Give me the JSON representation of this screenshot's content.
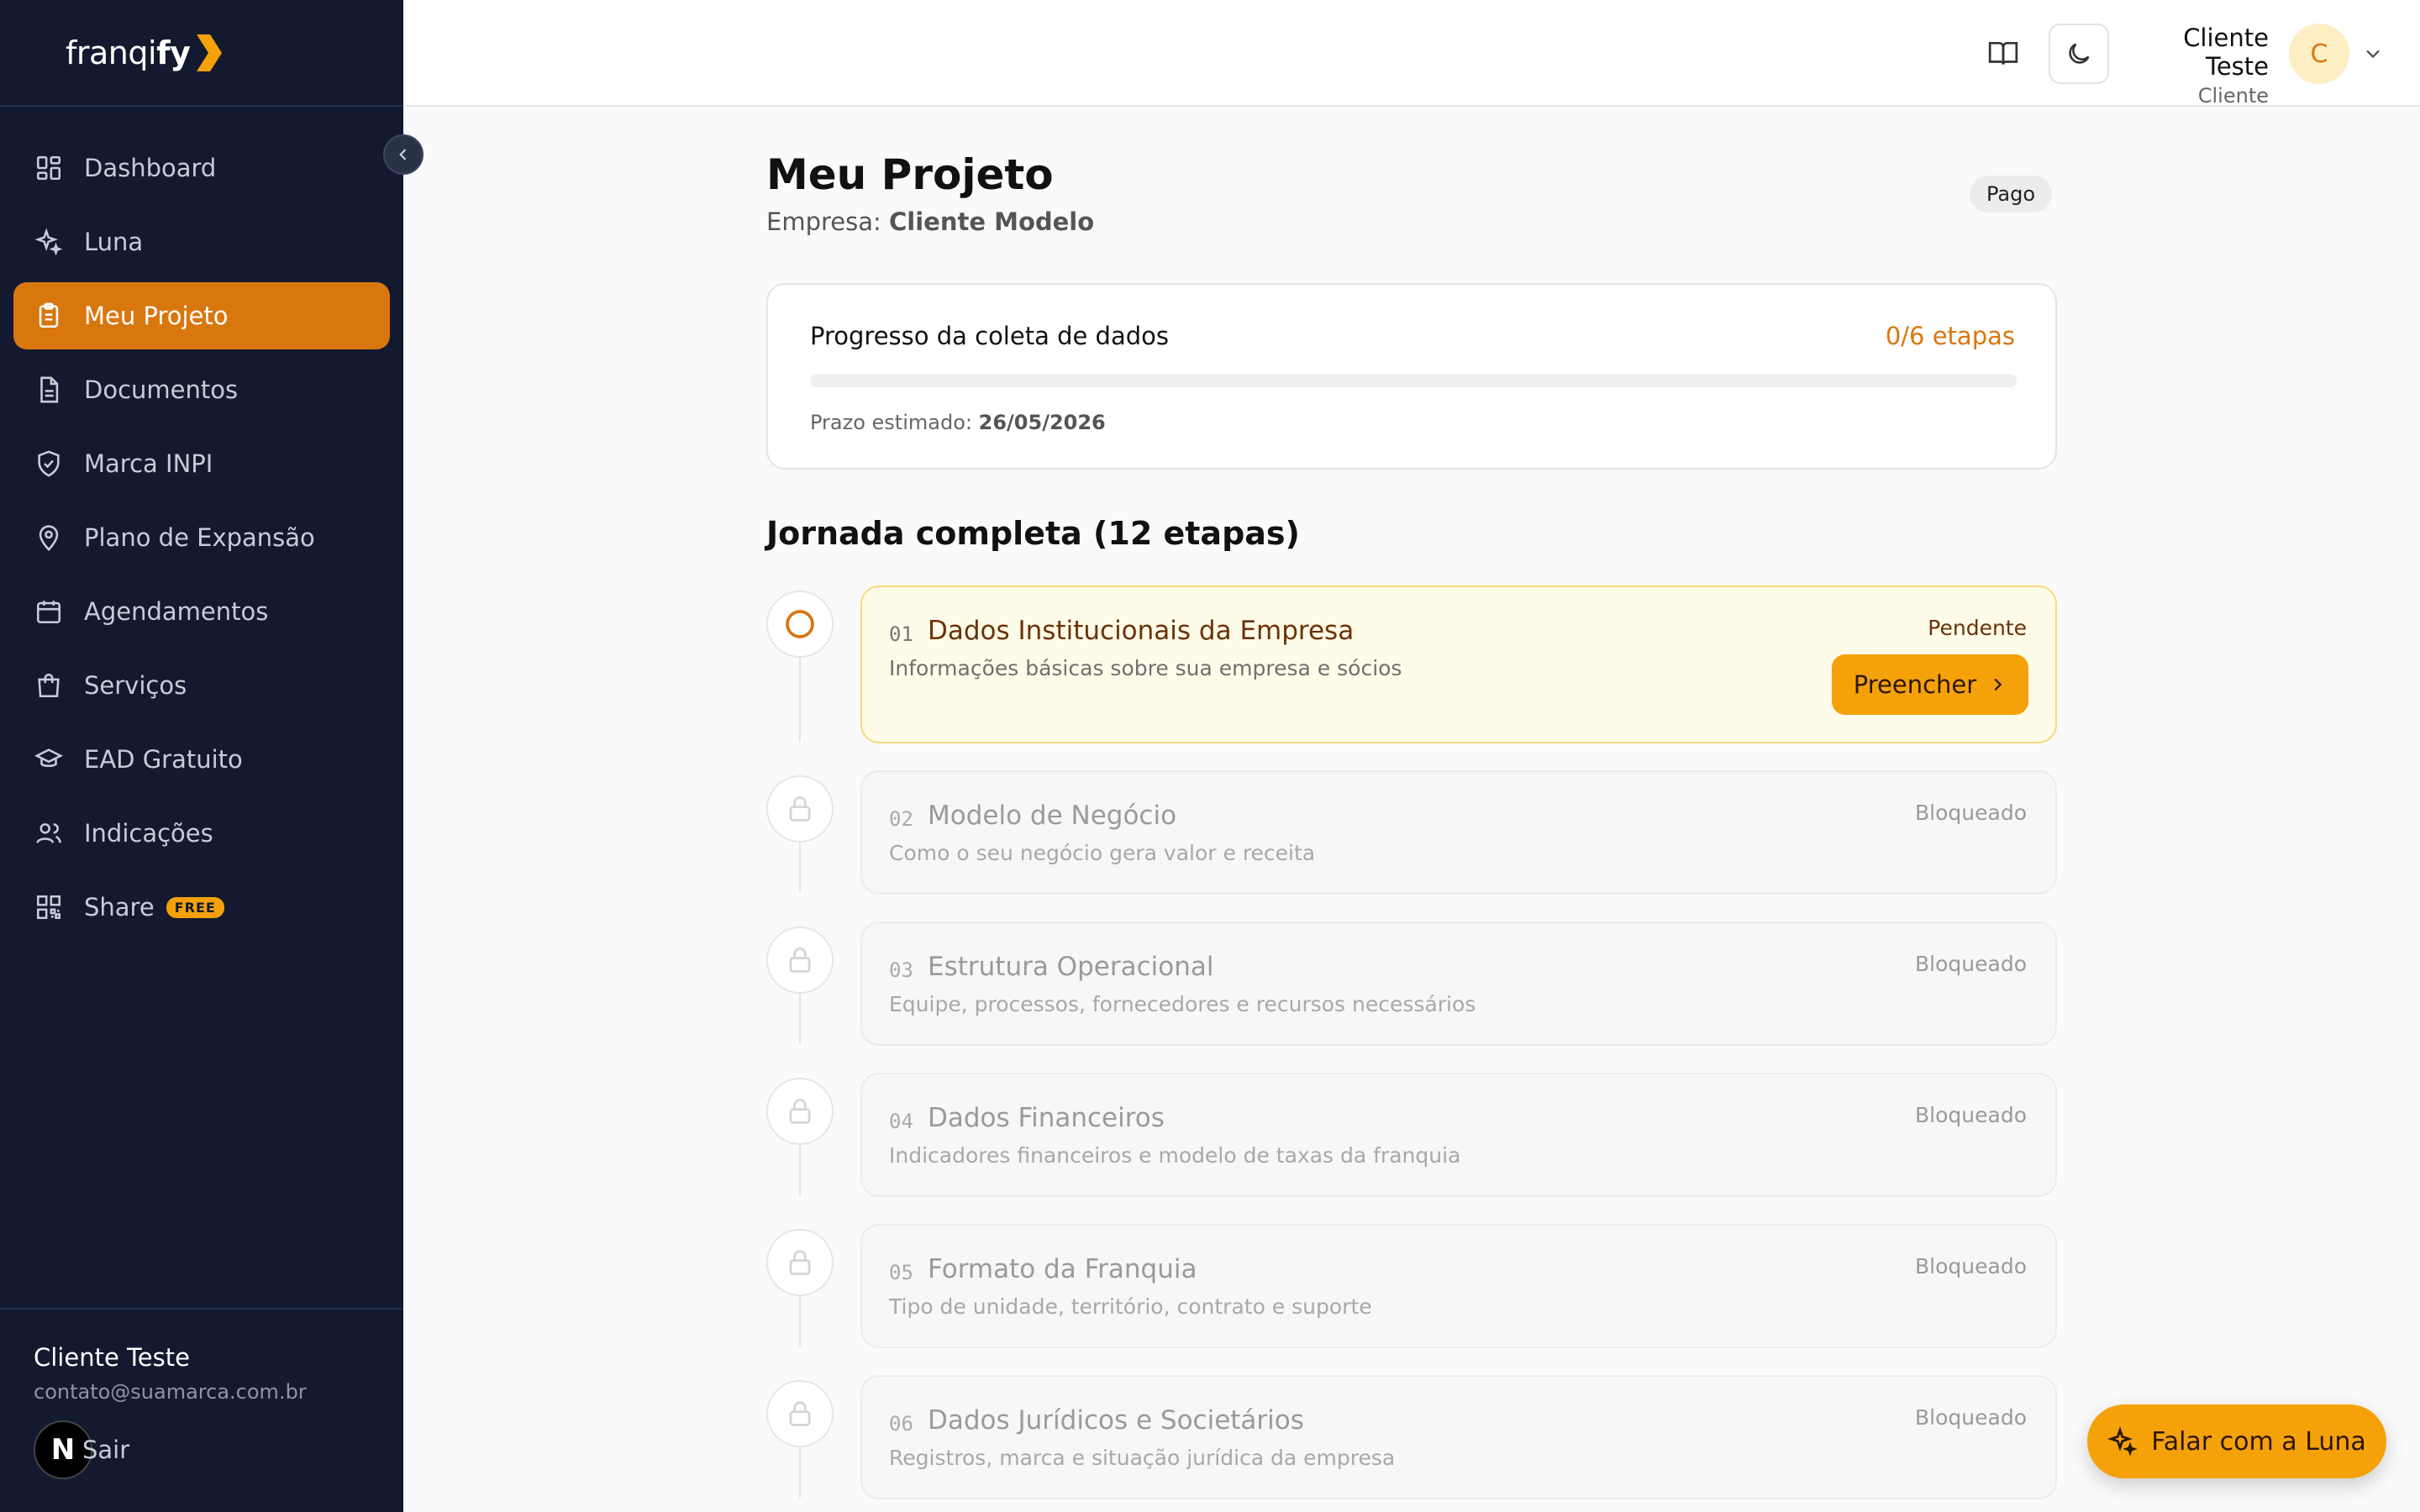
{
  "brand": {
    "name_prefix": "franqi",
    "name_bold": "fy"
  },
  "sidebar": {
    "items": [
      {
        "label": "Dashboard",
        "icon": "grid-icon"
      },
      {
        "label": "Luna",
        "icon": "sparkles-icon"
      },
      {
        "label": "Meu Projeto",
        "icon": "clipboard-icon",
        "active": true
      },
      {
        "label": "Documentos",
        "icon": "document-icon"
      },
      {
        "label": "Marca INPI",
        "icon": "shield-check-icon"
      },
      {
        "label": "Plano de Expansão",
        "icon": "map-pin-icon"
      },
      {
        "label": "Agendamentos",
        "icon": "calendar-icon"
      },
      {
        "label": "Serviços",
        "icon": "shopping-bag-icon"
      },
      {
        "label": "EAD Gratuito",
        "icon": "graduation-cap-icon"
      },
      {
        "label": "Indicações",
        "icon": "users-icon"
      },
      {
        "label": "Share",
        "icon": "qr-code-icon",
        "badge": "FREE"
      }
    ],
    "user": {
      "name": "Cliente Teste",
      "email": "contato@suamarca.com.br"
    },
    "logout_label": "Sair",
    "logout_badge": "N"
  },
  "header": {
    "user_name": "Cliente Teste",
    "user_role": "Cliente",
    "avatar_initial": "C"
  },
  "project": {
    "title": "Meu Projeto",
    "company_label": "Empresa:",
    "company_name": "Cliente Modelo",
    "status_badge": "Pago"
  },
  "progress": {
    "title": "Progresso da coleta de dados",
    "count": "0/6 etapas",
    "fraction": 0,
    "deadline_label": "Prazo estimado:",
    "deadline_value": "26/05/2026"
  },
  "journey": {
    "title": "Jornada completa (12 etapas)",
    "steps": [
      {
        "num": "01",
        "name": "Dados Institucionais da Empresa",
        "desc": "Informações básicas sobre sua empresa e sócios",
        "status": "Pendente",
        "action": "Preencher"
      },
      {
        "num": "02",
        "name": "Modelo de Negócio",
        "desc": "Como o seu negócio gera valor e receita",
        "status": "Bloqueado"
      },
      {
        "num": "03",
        "name": "Estrutura Operacional",
        "desc": "Equipe, processos, fornecedores e recursos necessários",
        "status": "Bloqueado"
      },
      {
        "num": "04",
        "name": "Dados Financeiros",
        "desc": "Indicadores financeiros e modelo de taxas da franquia",
        "status": "Bloqueado"
      },
      {
        "num": "05",
        "name": "Formato da Franquia",
        "desc": "Tipo de unidade, território, contrato e suporte",
        "status": "Bloqueado"
      },
      {
        "num": "06",
        "name": "Dados Jurídicos e Societários",
        "desc": "Registros, marca e situação jurídica da empresa",
        "status": "Bloqueado"
      }
    ]
  },
  "fab": {
    "label": "Falar com a Luna"
  },
  "colors": {
    "sidebar_bg": "#131a2f",
    "accent": "#f5a10a",
    "active_nav": "#d9770f"
  }
}
